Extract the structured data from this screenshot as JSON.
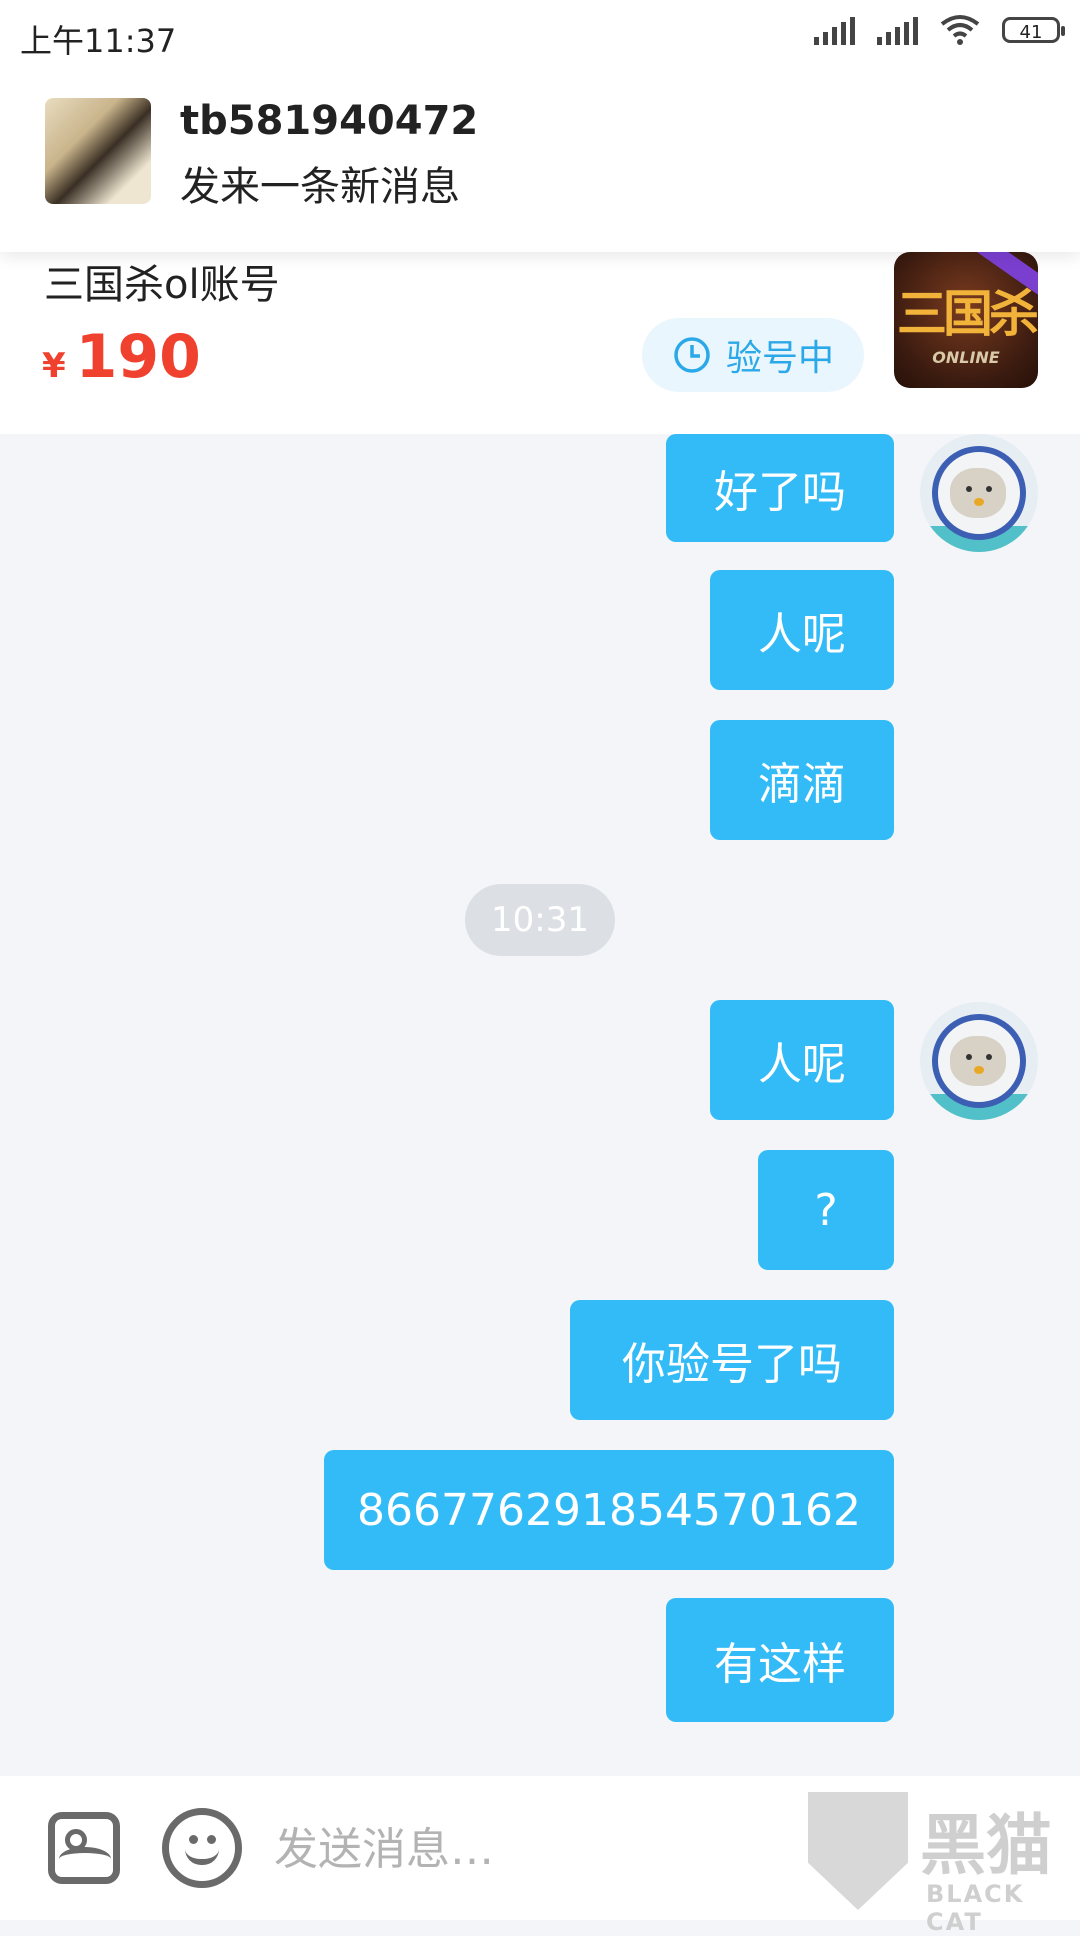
{
  "status_bar": {
    "time": "上午11:37",
    "battery": "41"
  },
  "notification": {
    "sender": "tb581940472",
    "message": "发来一条新消息"
  },
  "product": {
    "title": "三国杀ol账号",
    "currency": "¥",
    "price": "190",
    "status": "验号中",
    "game_icon_title": "三国杀",
    "game_icon_subtitle": "ONLINE"
  },
  "chat": {
    "messages": [
      {
        "text": "好了吗"
      },
      {
        "text": "人呢"
      },
      {
        "text": "滴滴"
      },
      {
        "text": "人呢"
      },
      {
        "text": "?"
      },
      {
        "text": "你验号了吗"
      },
      {
        "text": "866776291854570162"
      },
      {
        "text": "有这样"
      }
    ],
    "timestamp": "10:31"
  },
  "input": {
    "placeholder": "发送消息…"
  },
  "watermark": {
    "cn": "黑猫",
    "en": "BLACK CAT"
  },
  "colors": {
    "bubble": "#33bbf7",
    "price": "#f0402e",
    "status_text": "#2aa8e8"
  },
  "icons": [
    "signal-icon",
    "wifi-icon",
    "battery-icon",
    "clock-icon",
    "image-icon",
    "emoji-icon"
  ]
}
